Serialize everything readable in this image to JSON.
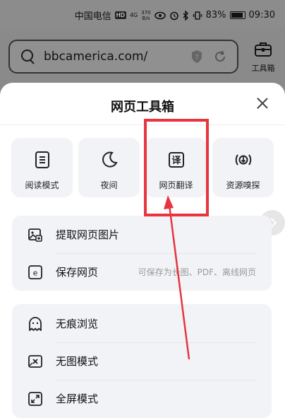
{
  "status_bar": {
    "carrier": "中国电信",
    "hd": "HD",
    "network": "4G",
    "speed_value": "370",
    "speed_unit": "B/s",
    "battery": "83%",
    "time": "09:30"
  },
  "address_bar": {
    "url": "bbcamerica.com/"
  },
  "toolbox_button": {
    "label": "工具箱"
  },
  "sheet": {
    "title": "网页工具箱",
    "tiles": [
      {
        "label": "阅读模式",
        "icon": "reading-mode-icon"
      },
      {
        "label": "夜间",
        "icon": "moon-icon"
      },
      {
        "label": "网页翻译",
        "icon": "translate-icon"
      },
      {
        "label": "资源嗅探",
        "icon": "resource-sniff-icon"
      }
    ],
    "group1": [
      {
        "label": "提取网页图片",
        "icon": "extract-images-icon"
      },
      {
        "label": "保存网页",
        "icon": "save-page-icon",
        "hint": "可保存为长图、PDF、离线网页"
      }
    ],
    "group2": [
      {
        "label": "无痕浏览",
        "icon": "incognito-icon"
      },
      {
        "label": "无图模式",
        "icon": "no-image-icon"
      },
      {
        "label": "全屏模式",
        "icon": "fullscreen-icon"
      }
    ]
  },
  "colors": {
    "annotation": "#e8343f",
    "sheet_bg": "#ffffff",
    "card_bg": "#f2f3f6"
  }
}
